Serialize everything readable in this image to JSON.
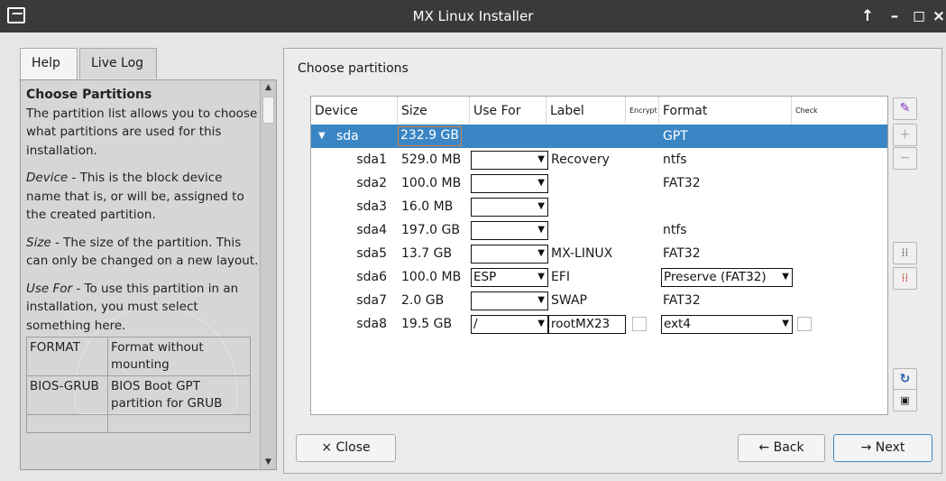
{
  "window": {
    "title": "MX Linux Installer",
    "controls": [
      "↑",
      "–",
      "◻",
      "×"
    ]
  },
  "tabs": [
    "Help",
    "Live Log"
  ],
  "help": {
    "heading": "Choose Partitions",
    "intro": "The partition list allows you to choose what partitions are used for this installation.",
    "device_term": "Device",
    "device_text": " - This is the block device name that is, or will be, assigned to the created partition.",
    "size_term": "Size",
    "size_text": " - The size of the partition. This can only be changed on a new layout.",
    "usefor_term": "Use For",
    "usefor_text": " - To use this partition in an installation, you must select something here.",
    "table": [
      {
        "key": "FORMAT",
        "desc": "Format without mounting"
      },
      {
        "key": "BIOS-GRUB",
        "desc": "BIOS Boot GPT partition for GRUB"
      }
    ]
  },
  "main": {
    "label": "Choose partitions",
    "columns": {
      "device": "Device",
      "size": "Size",
      "use_for": "Use For",
      "label": "Label",
      "encrypt": "Encrypt",
      "format": "Format",
      "check": "Check"
    },
    "disk": {
      "device": "sda",
      "size": "232.9 GB",
      "format": "GPT"
    },
    "partitions": [
      {
        "device": "sda1",
        "size": "529.0 MB",
        "use_for": "",
        "label": "Recovery",
        "format": "ntfs"
      },
      {
        "device": "sda2",
        "size": "100.0 MB",
        "use_for": "",
        "label": "",
        "format": "FAT32"
      },
      {
        "device": "sda3",
        "size": "16.0 MB",
        "use_for": "",
        "label": "",
        "format": ""
      },
      {
        "device": "sda4",
        "size": "197.0 GB",
        "use_for": "",
        "label": "",
        "format": "ntfs"
      },
      {
        "device": "sda5",
        "size": "13.7 GB",
        "use_for": "",
        "label": "MX-LINUX",
        "format": "FAT32"
      },
      {
        "device": "sda6",
        "size": "100.0 MB",
        "use_for": "ESP",
        "label": "EFI",
        "format": "Preserve (FAT32)"
      },
      {
        "device": "sda7",
        "size": "2.0 GB",
        "use_for": "",
        "label": "SWAP",
        "format": "FAT32"
      },
      {
        "device": "sda8",
        "size": "19.5 GB",
        "use_for": "/",
        "label": "rootMX23",
        "format": "ext4"
      }
    ]
  },
  "buttons": {
    "close": "× Close",
    "back": "← Back",
    "next": "→ Next"
  },
  "colors": {
    "selection": "#3a86c4",
    "titlebar": "#3a3a3a"
  }
}
